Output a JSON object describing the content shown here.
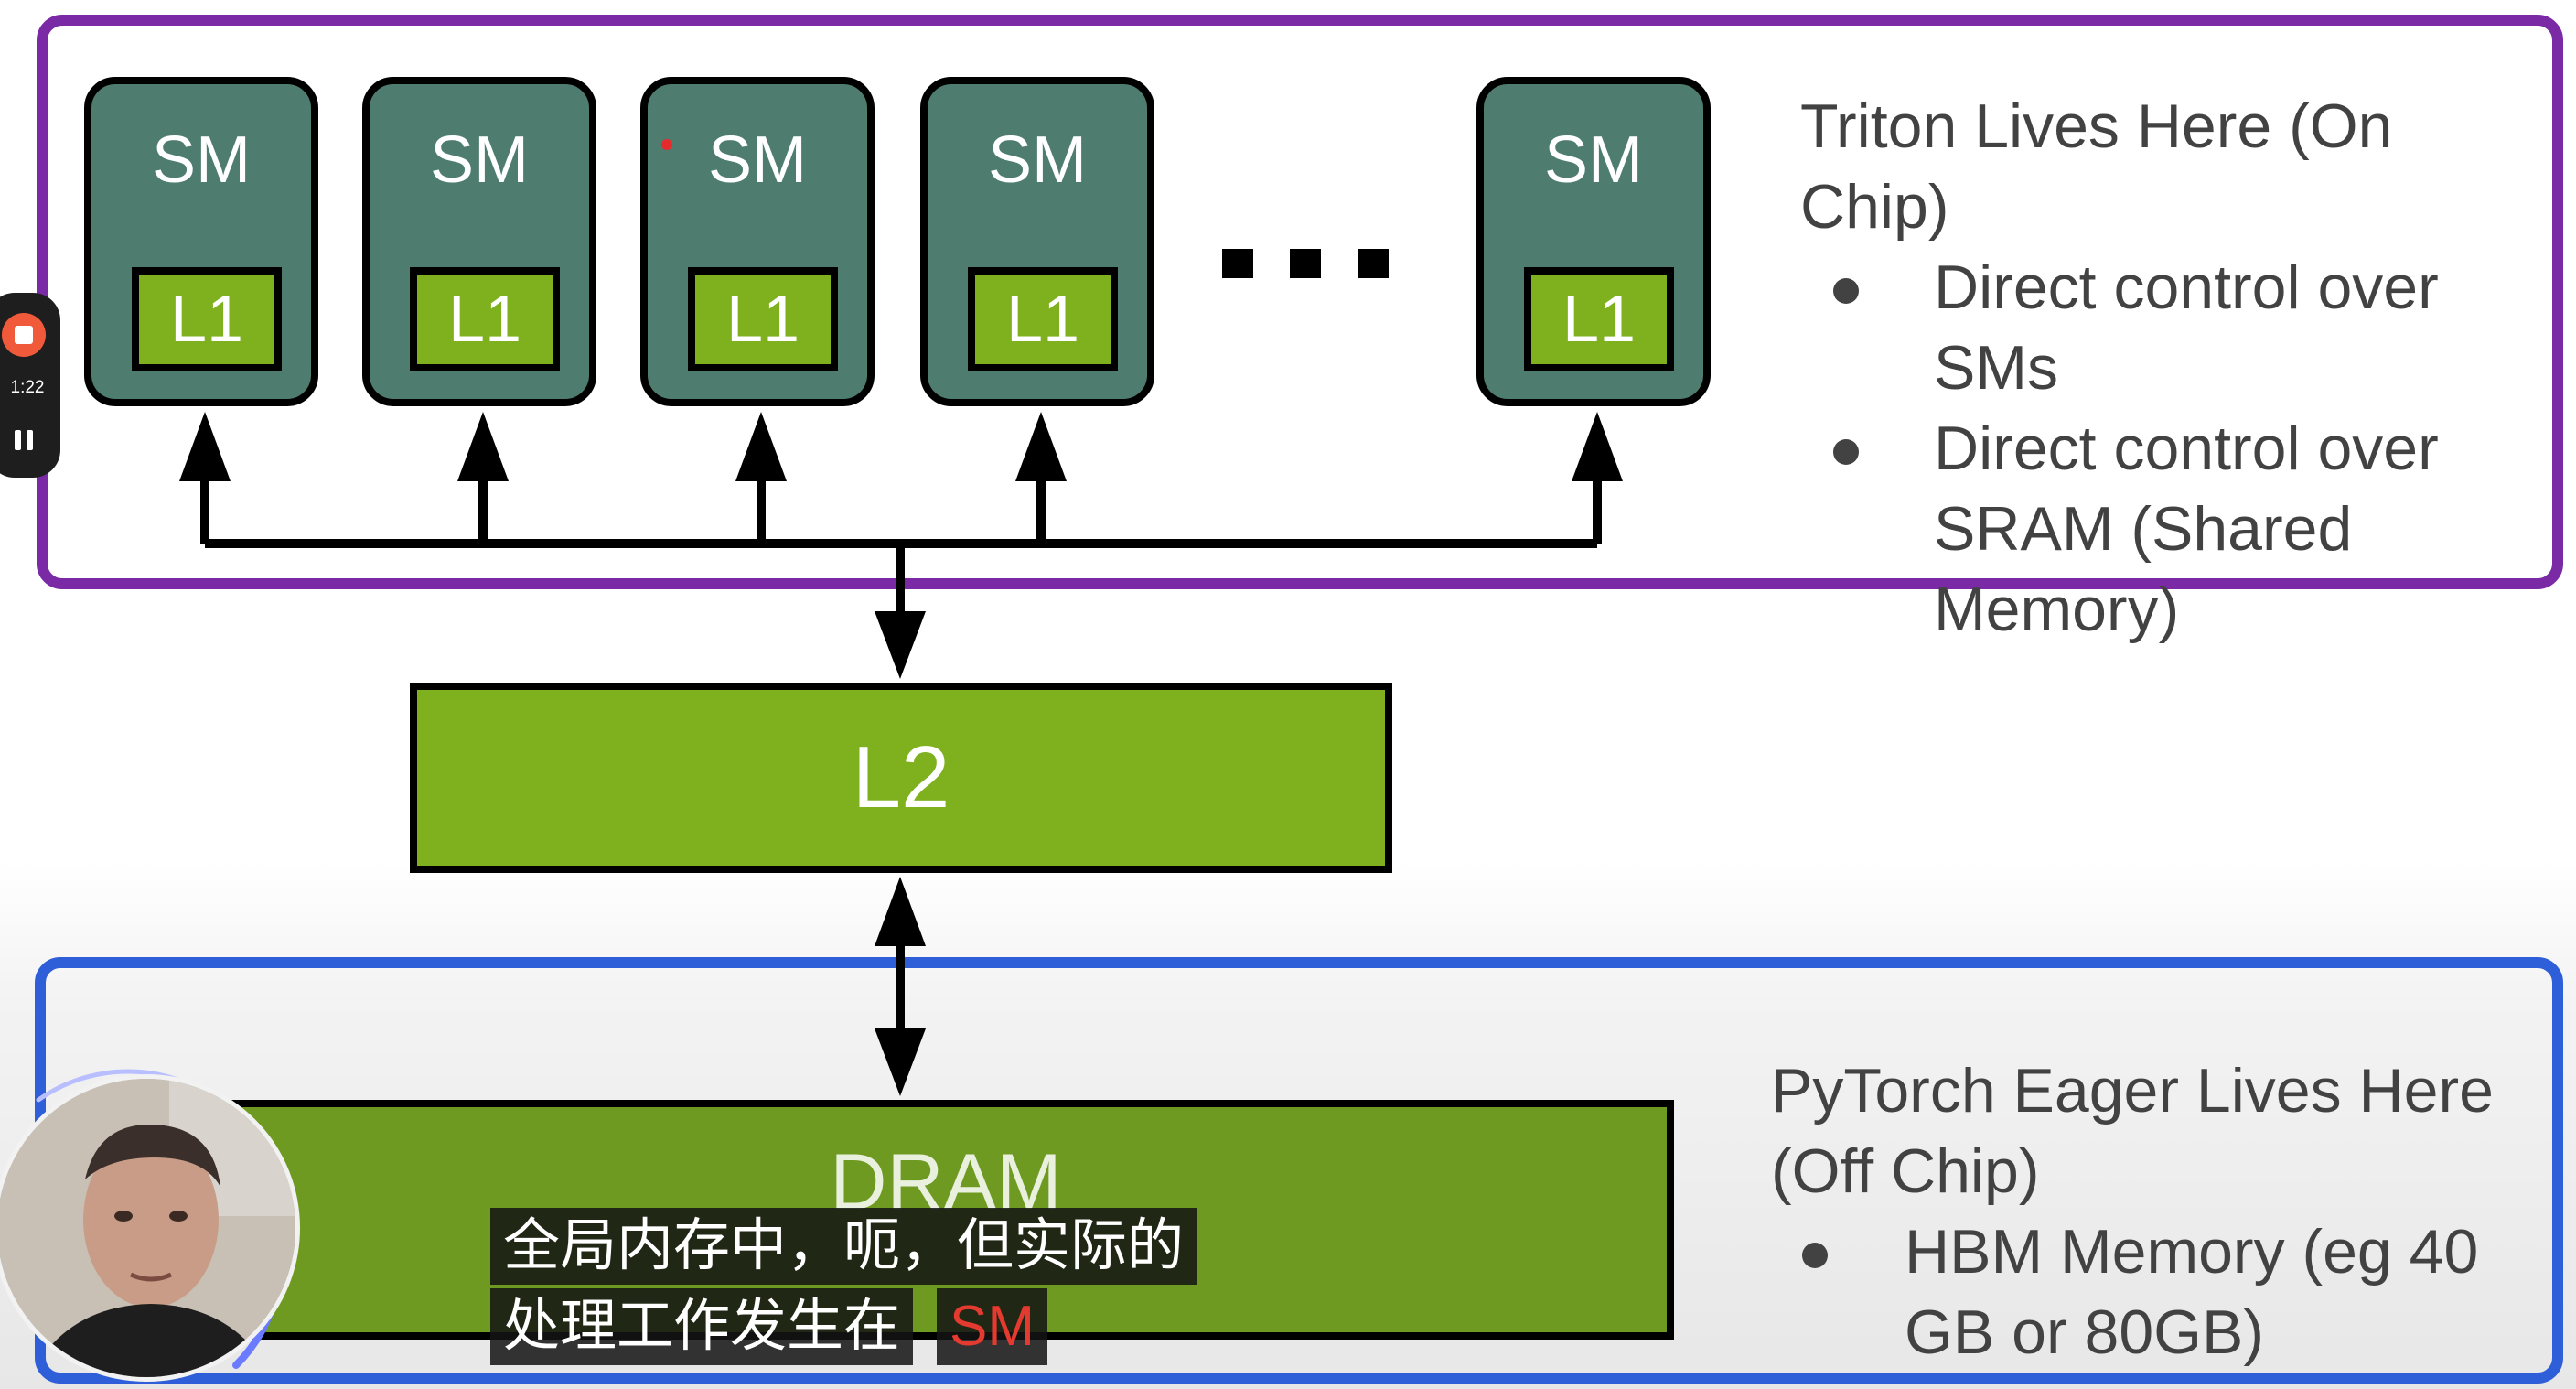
{
  "colors": {
    "on_chip_border": "#7a2aa5",
    "off_chip_border": "#2f5fd8",
    "sm_fill": "#4e7d70",
    "cache_fill": "#7fb11f",
    "dram_fill": "#6f9a22",
    "subtitle_highlight": "#e53a2f"
  },
  "sms": [
    {
      "label": "SM",
      "cache": "L1"
    },
    {
      "label": "SM",
      "cache": "L1"
    },
    {
      "label": "SM",
      "cache": "L1"
    },
    {
      "label": "SM",
      "cache": "L1"
    },
    {
      "label": "SM",
      "cache": "L1"
    }
  ],
  "l2": {
    "label": "L2"
  },
  "dram": {
    "label": "DRAM"
  },
  "triton": {
    "title": "Triton Lives Here (On Chip)",
    "bullets": [
      "Direct control over SMs",
      "Direct control over SRAM (Shared Memory)"
    ]
  },
  "pytorch": {
    "title": "PyTorch Eager Lives Here  (Off Chip)",
    "bullets": [
      "HBM Memory (eg 40 GB or 80GB)"
    ]
  },
  "subtitle": {
    "line1": "全局内存中，呃，但实际的",
    "line2": "处理工作发生在",
    "highlight": "SM"
  },
  "recorder": {
    "time": "1:22",
    "stop_icon": "stop-icon",
    "pause_icon": "pause-icon"
  }
}
